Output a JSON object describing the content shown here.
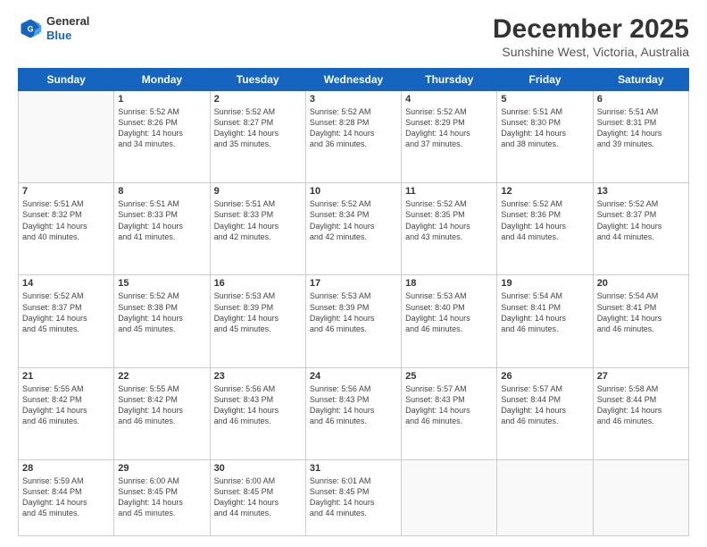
{
  "header": {
    "logo_line1": "General",
    "logo_line2": "Blue",
    "month_title": "December 2025",
    "subtitle": "Sunshine West, Victoria, Australia"
  },
  "days_of_week": [
    "Sunday",
    "Monday",
    "Tuesday",
    "Wednesday",
    "Thursday",
    "Friday",
    "Saturday"
  ],
  "weeks": [
    [
      {
        "day": "",
        "info": ""
      },
      {
        "day": "1",
        "info": "Sunrise: 5:52 AM\nSunset: 8:26 PM\nDaylight: 14 hours\nand 34 minutes."
      },
      {
        "day": "2",
        "info": "Sunrise: 5:52 AM\nSunset: 8:27 PM\nDaylight: 14 hours\nand 35 minutes."
      },
      {
        "day": "3",
        "info": "Sunrise: 5:52 AM\nSunset: 8:28 PM\nDaylight: 14 hours\nand 36 minutes."
      },
      {
        "day": "4",
        "info": "Sunrise: 5:52 AM\nSunset: 8:29 PM\nDaylight: 14 hours\nand 37 minutes."
      },
      {
        "day": "5",
        "info": "Sunrise: 5:51 AM\nSunset: 8:30 PM\nDaylight: 14 hours\nand 38 minutes."
      },
      {
        "day": "6",
        "info": "Sunrise: 5:51 AM\nSunset: 8:31 PM\nDaylight: 14 hours\nand 39 minutes."
      }
    ],
    [
      {
        "day": "7",
        "info": "Sunrise: 5:51 AM\nSunset: 8:32 PM\nDaylight: 14 hours\nand 40 minutes."
      },
      {
        "day": "8",
        "info": "Sunrise: 5:51 AM\nSunset: 8:33 PM\nDaylight: 14 hours\nand 41 minutes."
      },
      {
        "day": "9",
        "info": "Sunrise: 5:51 AM\nSunset: 8:33 PM\nDaylight: 14 hours\nand 42 minutes."
      },
      {
        "day": "10",
        "info": "Sunrise: 5:52 AM\nSunset: 8:34 PM\nDaylight: 14 hours\nand 42 minutes."
      },
      {
        "day": "11",
        "info": "Sunrise: 5:52 AM\nSunset: 8:35 PM\nDaylight: 14 hours\nand 43 minutes."
      },
      {
        "day": "12",
        "info": "Sunrise: 5:52 AM\nSunset: 8:36 PM\nDaylight: 14 hours\nand 44 minutes."
      },
      {
        "day": "13",
        "info": "Sunrise: 5:52 AM\nSunset: 8:37 PM\nDaylight: 14 hours\nand 44 minutes."
      }
    ],
    [
      {
        "day": "14",
        "info": "Sunrise: 5:52 AM\nSunset: 8:37 PM\nDaylight: 14 hours\nand 45 minutes."
      },
      {
        "day": "15",
        "info": "Sunrise: 5:52 AM\nSunset: 8:38 PM\nDaylight: 14 hours\nand 45 minutes."
      },
      {
        "day": "16",
        "info": "Sunrise: 5:53 AM\nSunset: 8:39 PM\nDaylight: 14 hours\nand 45 minutes."
      },
      {
        "day": "17",
        "info": "Sunrise: 5:53 AM\nSunset: 8:39 PM\nDaylight: 14 hours\nand 46 minutes."
      },
      {
        "day": "18",
        "info": "Sunrise: 5:53 AM\nSunset: 8:40 PM\nDaylight: 14 hours\nand 46 minutes."
      },
      {
        "day": "19",
        "info": "Sunrise: 5:54 AM\nSunset: 8:41 PM\nDaylight: 14 hours\nand 46 minutes."
      },
      {
        "day": "20",
        "info": "Sunrise: 5:54 AM\nSunset: 8:41 PM\nDaylight: 14 hours\nand 46 minutes."
      }
    ],
    [
      {
        "day": "21",
        "info": "Sunrise: 5:55 AM\nSunset: 8:42 PM\nDaylight: 14 hours\nand 46 minutes."
      },
      {
        "day": "22",
        "info": "Sunrise: 5:55 AM\nSunset: 8:42 PM\nDaylight: 14 hours\nand 46 minutes."
      },
      {
        "day": "23",
        "info": "Sunrise: 5:56 AM\nSunset: 8:43 PM\nDaylight: 14 hours\nand 46 minutes."
      },
      {
        "day": "24",
        "info": "Sunrise: 5:56 AM\nSunset: 8:43 PM\nDaylight: 14 hours\nand 46 minutes."
      },
      {
        "day": "25",
        "info": "Sunrise: 5:57 AM\nSunset: 8:43 PM\nDaylight: 14 hours\nand 46 minutes."
      },
      {
        "day": "26",
        "info": "Sunrise: 5:57 AM\nSunset: 8:44 PM\nDaylight: 14 hours\nand 46 minutes."
      },
      {
        "day": "27",
        "info": "Sunrise: 5:58 AM\nSunset: 8:44 PM\nDaylight: 14 hours\nand 46 minutes."
      }
    ],
    [
      {
        "day": "28",
        "info": "Sunrise: 5:59 AM\nSunset: 8:44 PM\nDaylight: 14 hours\nand 45 minutes."
      },
      {
        "day": "29",
        "info": "Sunrise: 6:00 AM\nSunset: 8:45 PM\nDaylight: 14 hours\nand 45 minutes."
      },
      {
        "day": "30",
        "info": "Sunrise: 6:00 AM\nSunset: 8:45 PM\nDaylight: 14 hours\nand 44 minutes."
      },
      {
        "day": "31",
        "info": "Sunrise: 6:01 AM\nSunset: 8:45 PM\nDaylight: 14 hours\nand 44 minutes."
      },
      {
        "day": "",
        "info": ""
      },
      {
        "day": "",
        "info": ""
      },
      {
        "day": "",
        "info": ""
      }
    ]
  ]
}
